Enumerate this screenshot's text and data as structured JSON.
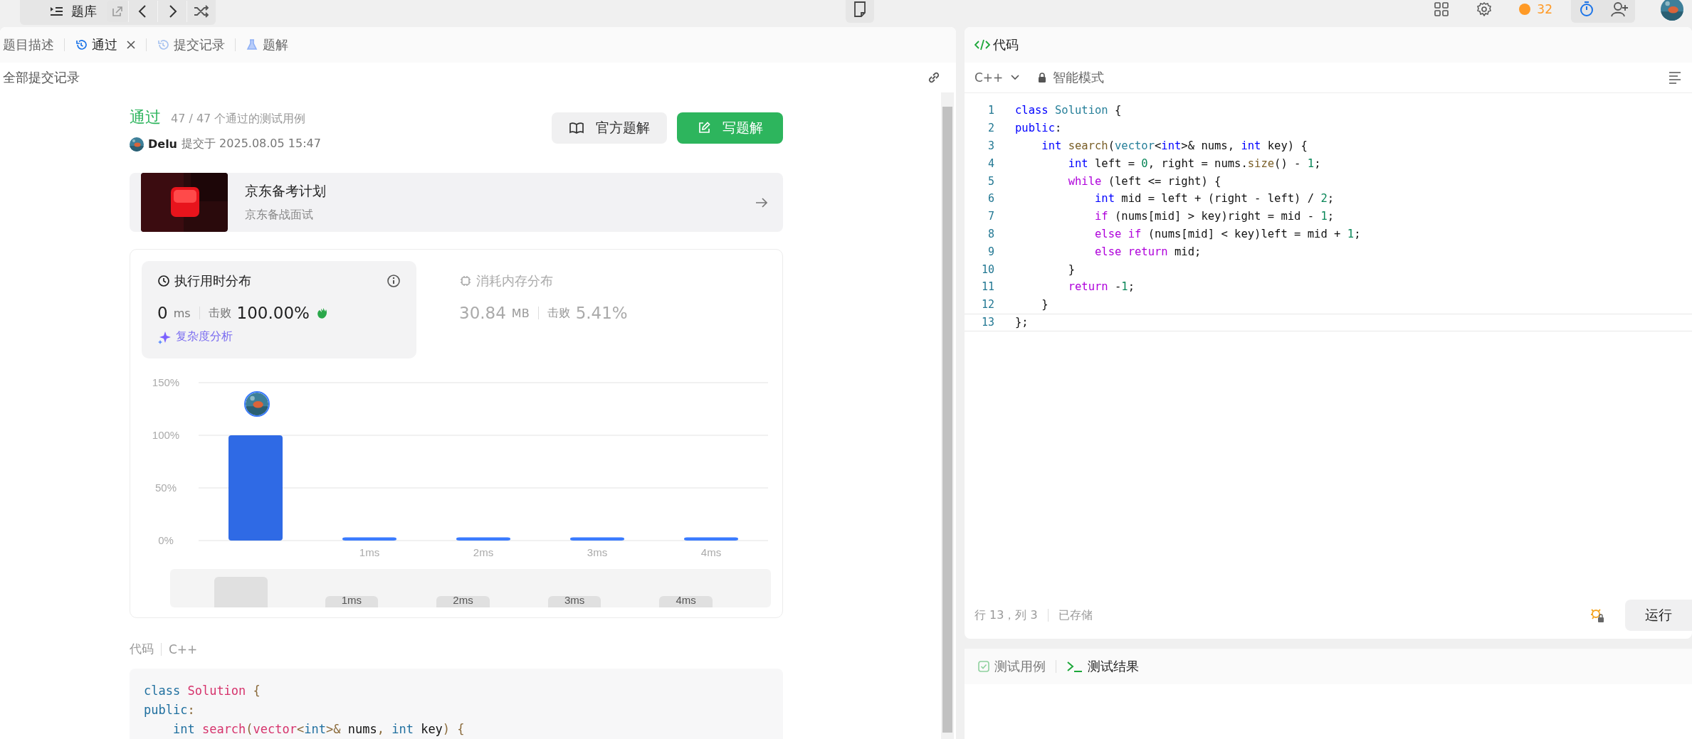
{
  "top_bar": {
    "problem_bank": "题库",
    "coins": "32"
  },
  "left_panel": {
    "tabs": [
      {
        "label": "题目描述",
        "kind": "plain",
        "selected": false,
        "closable": false
      },
      {
        "label": "通过",
        "kind": "history",
        "selected": true,
        "closable": true
      },
      {
        "label": "提交记录",
        "kind": "history",
        "selected": false,
        "closable": false
      },
      {
        "label": "题解",
        "kind": "solutions",
        "selected": false,
        "closable": false
      }
    ],
    "subheader": "全部提交记录",
    "result": {
      "status": "通过",
      "cases": "47 / 47 个通过的测试用例",
      "user": "Delu",
      "submitted": "提交于 2025.08.05 15:47"
    },
    "buttons": [
      {
        "label": "官方题解",
        "kind": "secondary"
      },
      {
        "label": "写题解",
        "kind": "primary"
      }
    ],
    "promo": {
      "title": "京东备考计划",
      "subtitle": "京东备战面试"
    },
    "stats": [
      {
        "title": "执行用时分布",
        "kind": "runtime",
        "selected": true,
        "value": "0",
        "unit": "ms",
        "beat_label": "击败",
        "beat": "100.00%"
      },
      {
        "title": "消耗内存分布",
        "kind": "memory",
        "selected": false,
        "value": "30.84",
        "unit": "MB",
        "beat_label": "击败",
        "beat": "5.41%"
      }
    ],
    "complexity_link": "复杂度分析",
    "chart_data": {
      "type": "bar",
      "x": [
        0,
        1,
        2,
        3,
        4
      ],
      "xlim": [
        -0.5,
        4.5
      ],
      "values": [
        100,
        3,
        3,
        3,
        3
      ],
      "ylim": [
        0,
        150
      ],
      "yticks": [
        {
          "value": 0,
          "label": "0%"
        },
        {
          "value": 50,
          "label": "50%"
        },
        {
          "value": 100,
          "label": "100%"
        },
        {
          "value": 150,
          "label": "150%"
        }
      ],
      "xticks": [
        {
          "value": 1,
          "label": "1ms"
        },
        {
          "value": 2,
          "label": "2ms"
        },
        {
          "value": 3,
          "label": "3ms"
        },
        {
          "value": 4,
          "label": "4ms"
        }
      ]
    },
    "overview_labels": [
      "1ms",
      "2ms",
      "3ms",
      "4ms"
    ],
    "code_label": "代码",
    "code_language": "C++",
    "code_lines": [
      "class Solution {",
      "public:",
      "    int search(vector<int>& nums, int key) {"
    ]
  },
  "editor": {
    "title": "代码",
    "language": "C++",
    "mode": "智能模式",
    "lines": [
      {
        "number": "1",
        "text": "class Solution {"
      },
      {
        "number": "2",
        "text": "public:"
      },
      {
        "number": "3",
        "text": "    int search(vector<int>& nums, int key) {"
      },
      {
        "number": "4",
        "text": "        int left = 0, right = nums.size() - 1;"
      },
      {
        "number": "5",
        "text": "        while (left <= right) {"
      },
      {
        "number": "6",
        "text": "            int mid = left + (right - left) / 2;"
      },
      {
        "number": "7",
        "text": "            if (nums[mid] > key)right = mid - 1;"
      },
      {
        "number": "8",
        "text": "            else if (nums[mid] < key)left = mid + 1;"
      },
      {
        "number": "9",
        "text": "            else return mid;"
      },
      {
        "number": "10",
        "text": "        }"
      },
      {
        "number": "11",
        "text": "        return -1;"
      },
      {
        "number": "12",
        "text": "    }"
      },
      {
        "number": "13",
        "text": "};"
      }
    ],
    "cursor": "行 13，列 3",
    "saved": "已存储",
    "run_button": "运行",
    "bottom_tabs": [
      {
        "label": "测试用例",
        "kind": "testcase",
        "selected": false
      },
      {
        "label": "测试结果",
        "kind": "result",
        "selected": true
      }
    ]
  }
}
